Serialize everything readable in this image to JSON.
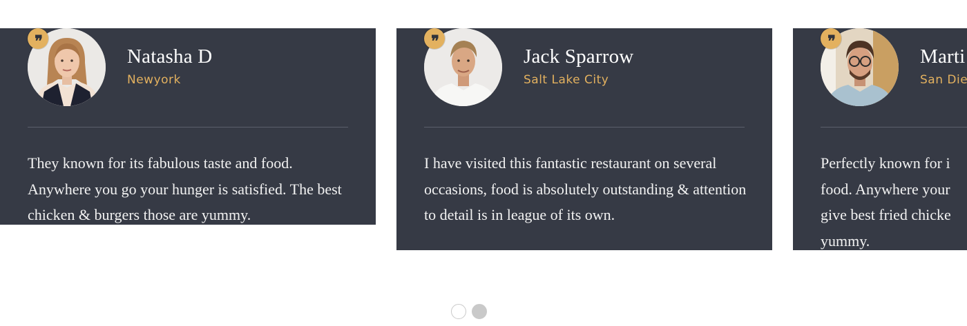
{
  "testimonials": [
    {
      "name": "Natasha D",
      "city": "Newyork",
      "review": "They known for its fabulous taste and food. Anywhere you go your hunger is satisfied. The best chicken & burgers those are yummy.",
      "avatar_icon": "portrait-woman"
    },
    {
      "name": "Jack Sparrow",
      "city": "Salt Lake City",
      "review": "I have visited this fantastic restaurant on several occasions, food is absolutely outstanding & attention to detail is in league of its own.",
      "avatar_icon": "portrait-man"
    },
    {
      "name": "Marti",
      "city": "San Die",
      "review": "Perfectly known for i\nfood. Anywhere your\ngive best fried chicke\nyummy.",
      "avatar_icon": "portrait-man-glasses"
    }
  ],
  "quote_glyph": "❞",
  "colors": {
    "card_background": "#363a45",
    "accent": "#e3b15f",
    "name_text": "#ffffff",
    "divider": "#5c606c",
    "dot_active": "#c9c9c9",
    "dot_inactive": "#ffffff"
  },
  "pagination": {
    "count": 2,
    "active_index": 1
  }
}
